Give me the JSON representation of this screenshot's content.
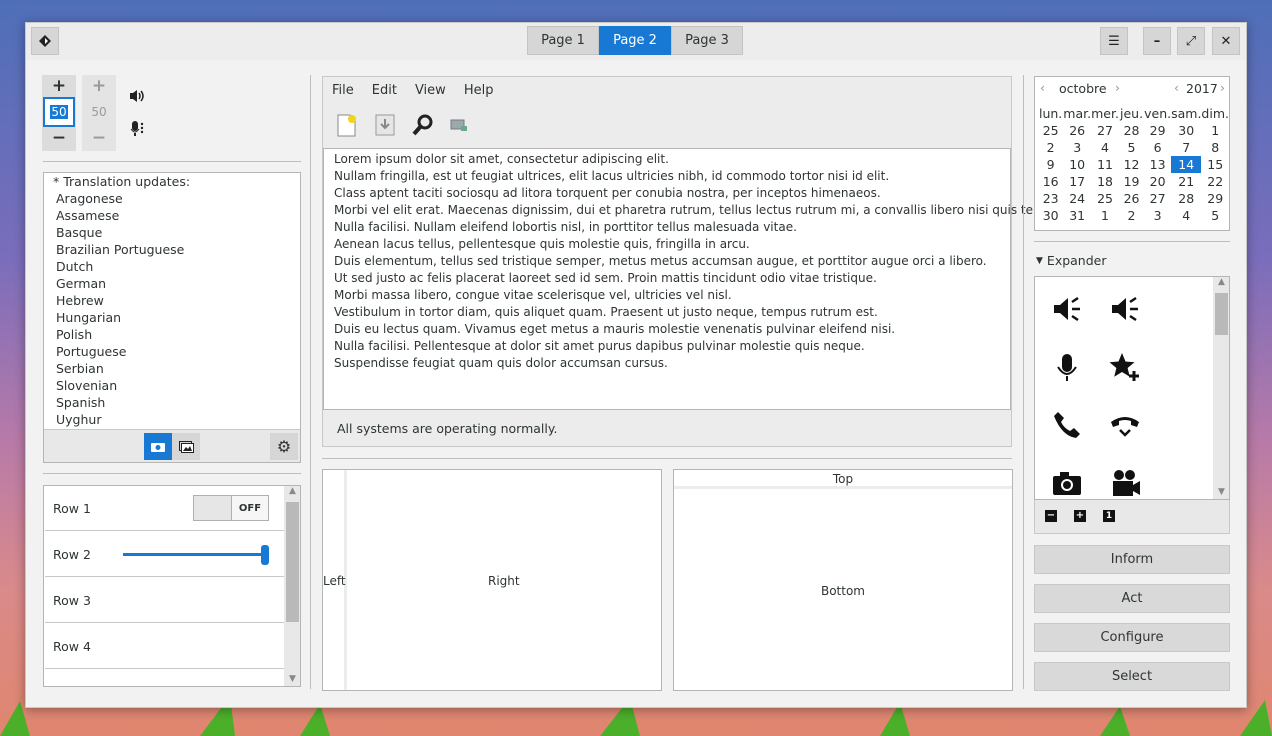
{
  "titlebar": {
    "tabs": [
      "Page 1",
      "Page 2",
      "Page 3"
    ],
    "active_tab": 1
  },
  "spinners": {
    "volume": {
      "value": "50",
      "plus": "+",
      "minus": "−"
    },
    "mic": {
      "value": "50",
      "plus": "+",
      "minus": "−"
    }
  },
  "languages": [
    "* Translation updates:",
    "Aragonese",
    "Assamese",
    "Basque",
    "Brazilian Portuguese",
    "Dutch",
    "German",
    "Hebrew",
    "Hungarian",
    "Polish",
    "Portuguese",
    "Serbian",
    "Slovenian",
    "Spanish",
    "Uyghur"
  ],
  "rows": {
    "row1": "Row 1",
    "row2": "Row 2",
    "row3": "Row 3",
    "row4": "Row 4",
    "switch_label": "OFF",
    "slider_value": 1.0
  },
  "menu": [
    "File",
    "Edit",
    "View",
    "Help"
  ],
  "text_lines": [
    "Lorem ipsum dolor sit amet, consectetur adipiscing elit.",
    "Nullam fringilla, est ut feugiat ultrices, elit lacus ultricies nibh, id commodo tortor nisi id elit.",
    "Class aptent taciti sociosqu ad litora torquent per conubia nostra, per inceptos himenaeos.",
    "Morbi vel elit erat. Maecenas dignissim, dui et pharetra rutrum, tellus lectus rutrum mi, a convallis libero nisi quis tellus.",
    "Nulla facilisi. Nullam eleifend lobortis nisl, in porttitor tellus malesuada vitae.",
    "Aenean lacus tellus, pellentesque quis molestie quis, fringilla in arcu.",
    "Duis elementum, tellus sed tristique semper, metus metus accumsan augue, et porttitor augue orci a libero.",
    "Ut sed justo ac felis placerat laoreet sed id sem. Proin mattis tincidunt odio vitae tristique.",
    "Morbi massa libero, congue vitae scelerisque vel, ultricies vel nisl.",
    "Vestibulum in tortor diam, quis aliquet quam. Praesent ut justo neque, tempus rutrum est.",
    "Duis eu lectus quam. Vivamus eget metus a mauris molestie venenatis pulvinar eleifend nisi.",
    "Nulla facilisi. Pellentesque at dolor sit amet purus dapibus pulvinar molestie quis neque.",
    "Suspendisse feugiat quam quis dolor accumsan cursus."
  ],
  "status": "All systems are operating normally.",
  "panes": {
    "left": "Left",
    "right": "Right",
    "top": "Top",
    "bottom": "Bottom"
  },
  "calendar": {
    "month": "octobre",
    "year": "2017",
    "days": [
      "lun.",
      "mar.",
      "mer.",
      "jeu.",
      "ven.",
      "sam.",
      "dim."
    ],
    "weeks": [
      [
        "25",
        "26",
        "27",
        "28",
        "29",
        "30",
        "1"
      ],
      [
        "2",
        "3",
        "4",
        "5",
        "6",
        "7",
        "8"
      ],
      [
        "9",
        "10",
        "11",
        "12",
        "13",
        "14",
        "15"
      ],
      [
        "16",
        "17",
        "18",
        "19",
        "20",
        "21",
        "22"
      ],
      [
        "23",
        "24",
        "25",
        "26",
        "27",
        "28",
        "29"
      ],
      [
        "30",
        "31",
        "1",
        "2",
        "3",
        "4",
        "5"
      ]
    ],
    "selected": "14"
  },
  "expander": {
    "label": "Expander"
  },
  "buttons": {
    "inform": "Inform",
    "act": "Act",
    "configure": "Configure",
    "select": "Select"
  },
  "colors": {
    "accent": "#1779d4"
  }
}
